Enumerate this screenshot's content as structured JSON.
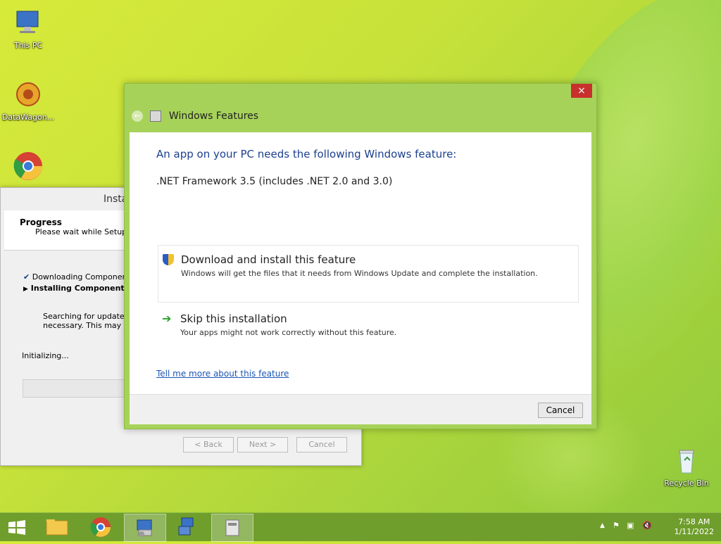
{
  "desktop": {
    "icons": [
      {
        "label": "This PC"
      },
      {
        "label": "DataWagon..."
      },
      {
        "label": ""
      },
      {
        "label": "Recycle Bin"
      }
    ]
  },
  "installer": {
    "title": "Insta",
    "header_title": "Progress",
    "header_sub": "Please wait while Setup co",
    "step1": "Downloading Components",
    "step2": "Installing Components",
    "search_text_1": "Searching for updated D",
    "search_text_2": "necessary. This may tak",
    "initializing": "Initializing...",
    "buttons": {
      "back": "< Back",
      "next": "Next >",
      "cancel": "Cancel"
    }
  },
  "dialog": {
    "close_icon": "×",
    "title": "Windows Features",
    "heading": "An app on your PC needs the following Windows feature:",
    "feature": ".NET Framework 3.5 (includes .NET 2.0 and 3.0)",
    "option_download_title": "Download and install this feature",
    "option_download_desc": "Windows will get the files that it needs from Windows Update and complete the installation.",
    "option_skip_title": "Skip this installation",
    "option_skip_desc": "Your apps might not work correctly without this feature.",
    "more_link": "Tell me more about this feature",
    "cancel_label": "Cancel"
  },
  "taskbar": {
    "time": "7:58 AM",
    "date": "1/11/2022"
  },
  "colors": {
    "accent": "#a7d25a",
    "taskbar": "#6f9e2c",
    "heading_blue": "#1c3f8f",
    "close_red": "#c7302c"
  }
}
